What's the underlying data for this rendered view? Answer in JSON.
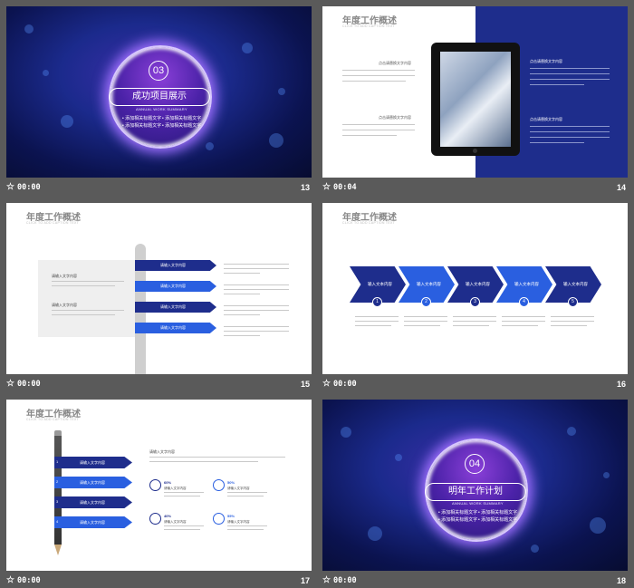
{
  "slides": [
    {
      "num": "13",
      "time": "00:00",
      "circle_num": "03",
      "title": "成功项目展示",
      "subtitle": "ANNUAL WORK SUMMARY",
      "bullets": [
        "添加相关标题文字",
        "添加相关标题文字",
        "添加相关标题文字",
        "添加相关标题文字"
      ]
    },
    {
      "num": "14",
      "time": "00:04",
      "title": "年度工作概述",
      "subtitle": "CLICK TO ADD CAPTION TEXT",
      "heading": "点击请替换文字内容",
      "heading2": "点击请替换文字内容",
      "heading3": "点击请替换文字内容",
      "heading4": "点击请替换文字内容"
    },
    {
      "num": "15",
      "time": "00:00",
      "title": "年度工作概述",
      "subtitle": "CLICK TO ADD CAPTION TEXT",
      "box_label1": "请输入文字内容",
      "box_label2": "请输入文字内容",
      "items": [
        "请输入文字内容",
        "请输入文字内容",
        "请输入文字内容",
        "请输入文字内容"
      ]
    },
    {
      "num": "16",
      "time": "00:00",
      "title": "年度工作概述",
      "subtitle": "CLICK TO ADD CAPTION TEXT",
      "chevrons": [
        "输入文本内容",
        "输入文本内容",
        "输入文本内容",
        "输入文本内容",
        "输入文本内容"
      ],
      "nums": [
        "1",
        "2",
        "3",
        "4",
        "5"
      ]
    },
    {
      "num": "17",
      "time": "00:00",
      "title": "年度工作概述",
      "subtitle": "CLICK TO ADD CAPTION TEXT",
      "items": [
        "请输入文字内容",
        "请输入文字内容",
        "请输入文字内容",
        "请输入文字内容"
      ],
      "nums": [
        "1",
        "2",
        "3",
        "4"
      ],
      "heading": "请输入文字内容",
      "stats": [
        {
          "pct": "60%",
          "label": "请输入文字内容"
        },
        {
          "pct": "50%",
          "label": "请输入文字内容"
        },
        {
          "pct": "40%",
          "label": "请输入文字内容"
        },
        {
          "pct": "55%",
          "label": "请输入文字内容"
        }
      ]
    },
    {
      "num": "18",
      "time": "00:00",
      "circle_num": "04",
      "title": "明年工作计划",
      "subtitle": "ANNUAL WORK SUMMARY",
      "bullets": [
        "添加相关标题文字",
        "添加相关标题文字",
        "添加相关标题文字",
        "添加相关标题文字"
      ]
    }
  ],
  "colors": {
    "navy": "#1e2d8c",
    "blue": "#2a5fe0",
    "background": "#5a5a5a"
  },
  "icons": [
    "star-icon",
    "tablet-photo",
    "clock-icon",
    "runner-icon",
    "speedometer-icon",
    "bulb-icon",
    "pencil-icon"
  ]
}
